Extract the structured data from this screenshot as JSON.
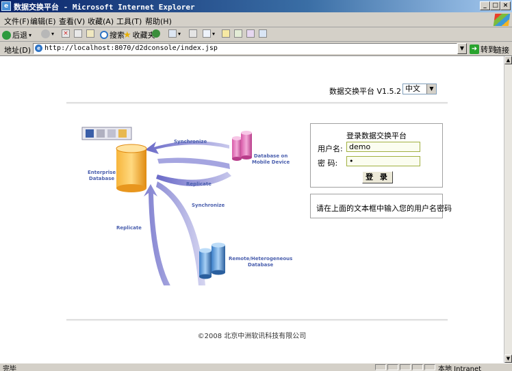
{
  "window": {
    "title": "数据交换平台 - Microsoft Internet Explorer",
    "buttons": [
      "_",
      "□",
      "×"
    ]
  },
  "menu": [
    "文件(F)",
    "编辑(E)",
    "查看(V)",
    "收藏(A)",
    "工具(T)",
    "帮助(H)"
  ],
  "toolbar": {
    "back": "后退",
    "search": "搜索",
    "favorites": "收藏夹"
  },
  "address": {
    "label": "地址(D)",
    "url": "http://localhost:8070/d2dconsole/index.jsp",
    "go": "转到",
    "links": "链接"
  },
  "page": {
    "app_name": "数据交换平台 V1.5.2",
    "language": "中文",
    "login": {
      "title": "登录数据交换平台",
      "username_label": "用户名:",
      "username_value": "demo",
      "password_label": "密  码:",
      "password_value": "•",
      "submit": "登 录"
    },
    "hint": "请在上面的文本框中输入您的用户名密码",
    "copyright": "©2008 北京中洲软讯科技有限公司",
    "diagram": {
      "enterprise_db": [
        "Enterprise",
        "Database"
      ],
      "mobile_db": [
        "Database on",
        "Mobile Device"
      ],
      "remote_db": [
        "Remote/Heterogeneous",
        "Database"
      ],
      "sync1": "Synchronize",
      "replicate1": "Replicate",
      "sync2": "Synchronize",
      "replicate2": "Replicate"
    }
  },
  "status": {
    "left": "完毕",
    "zone": "本地 Intranet"
  },
  "colors": {
    "titlebar": "#0a246a",
    "arrow": "#6f6fc4",
    "label_blue": "#4a5fae",
    "db_orange": "#f5a623",
    "db_pink": "#e06ab4",
    "db_blue": "#4a8fd6"
  }
}
